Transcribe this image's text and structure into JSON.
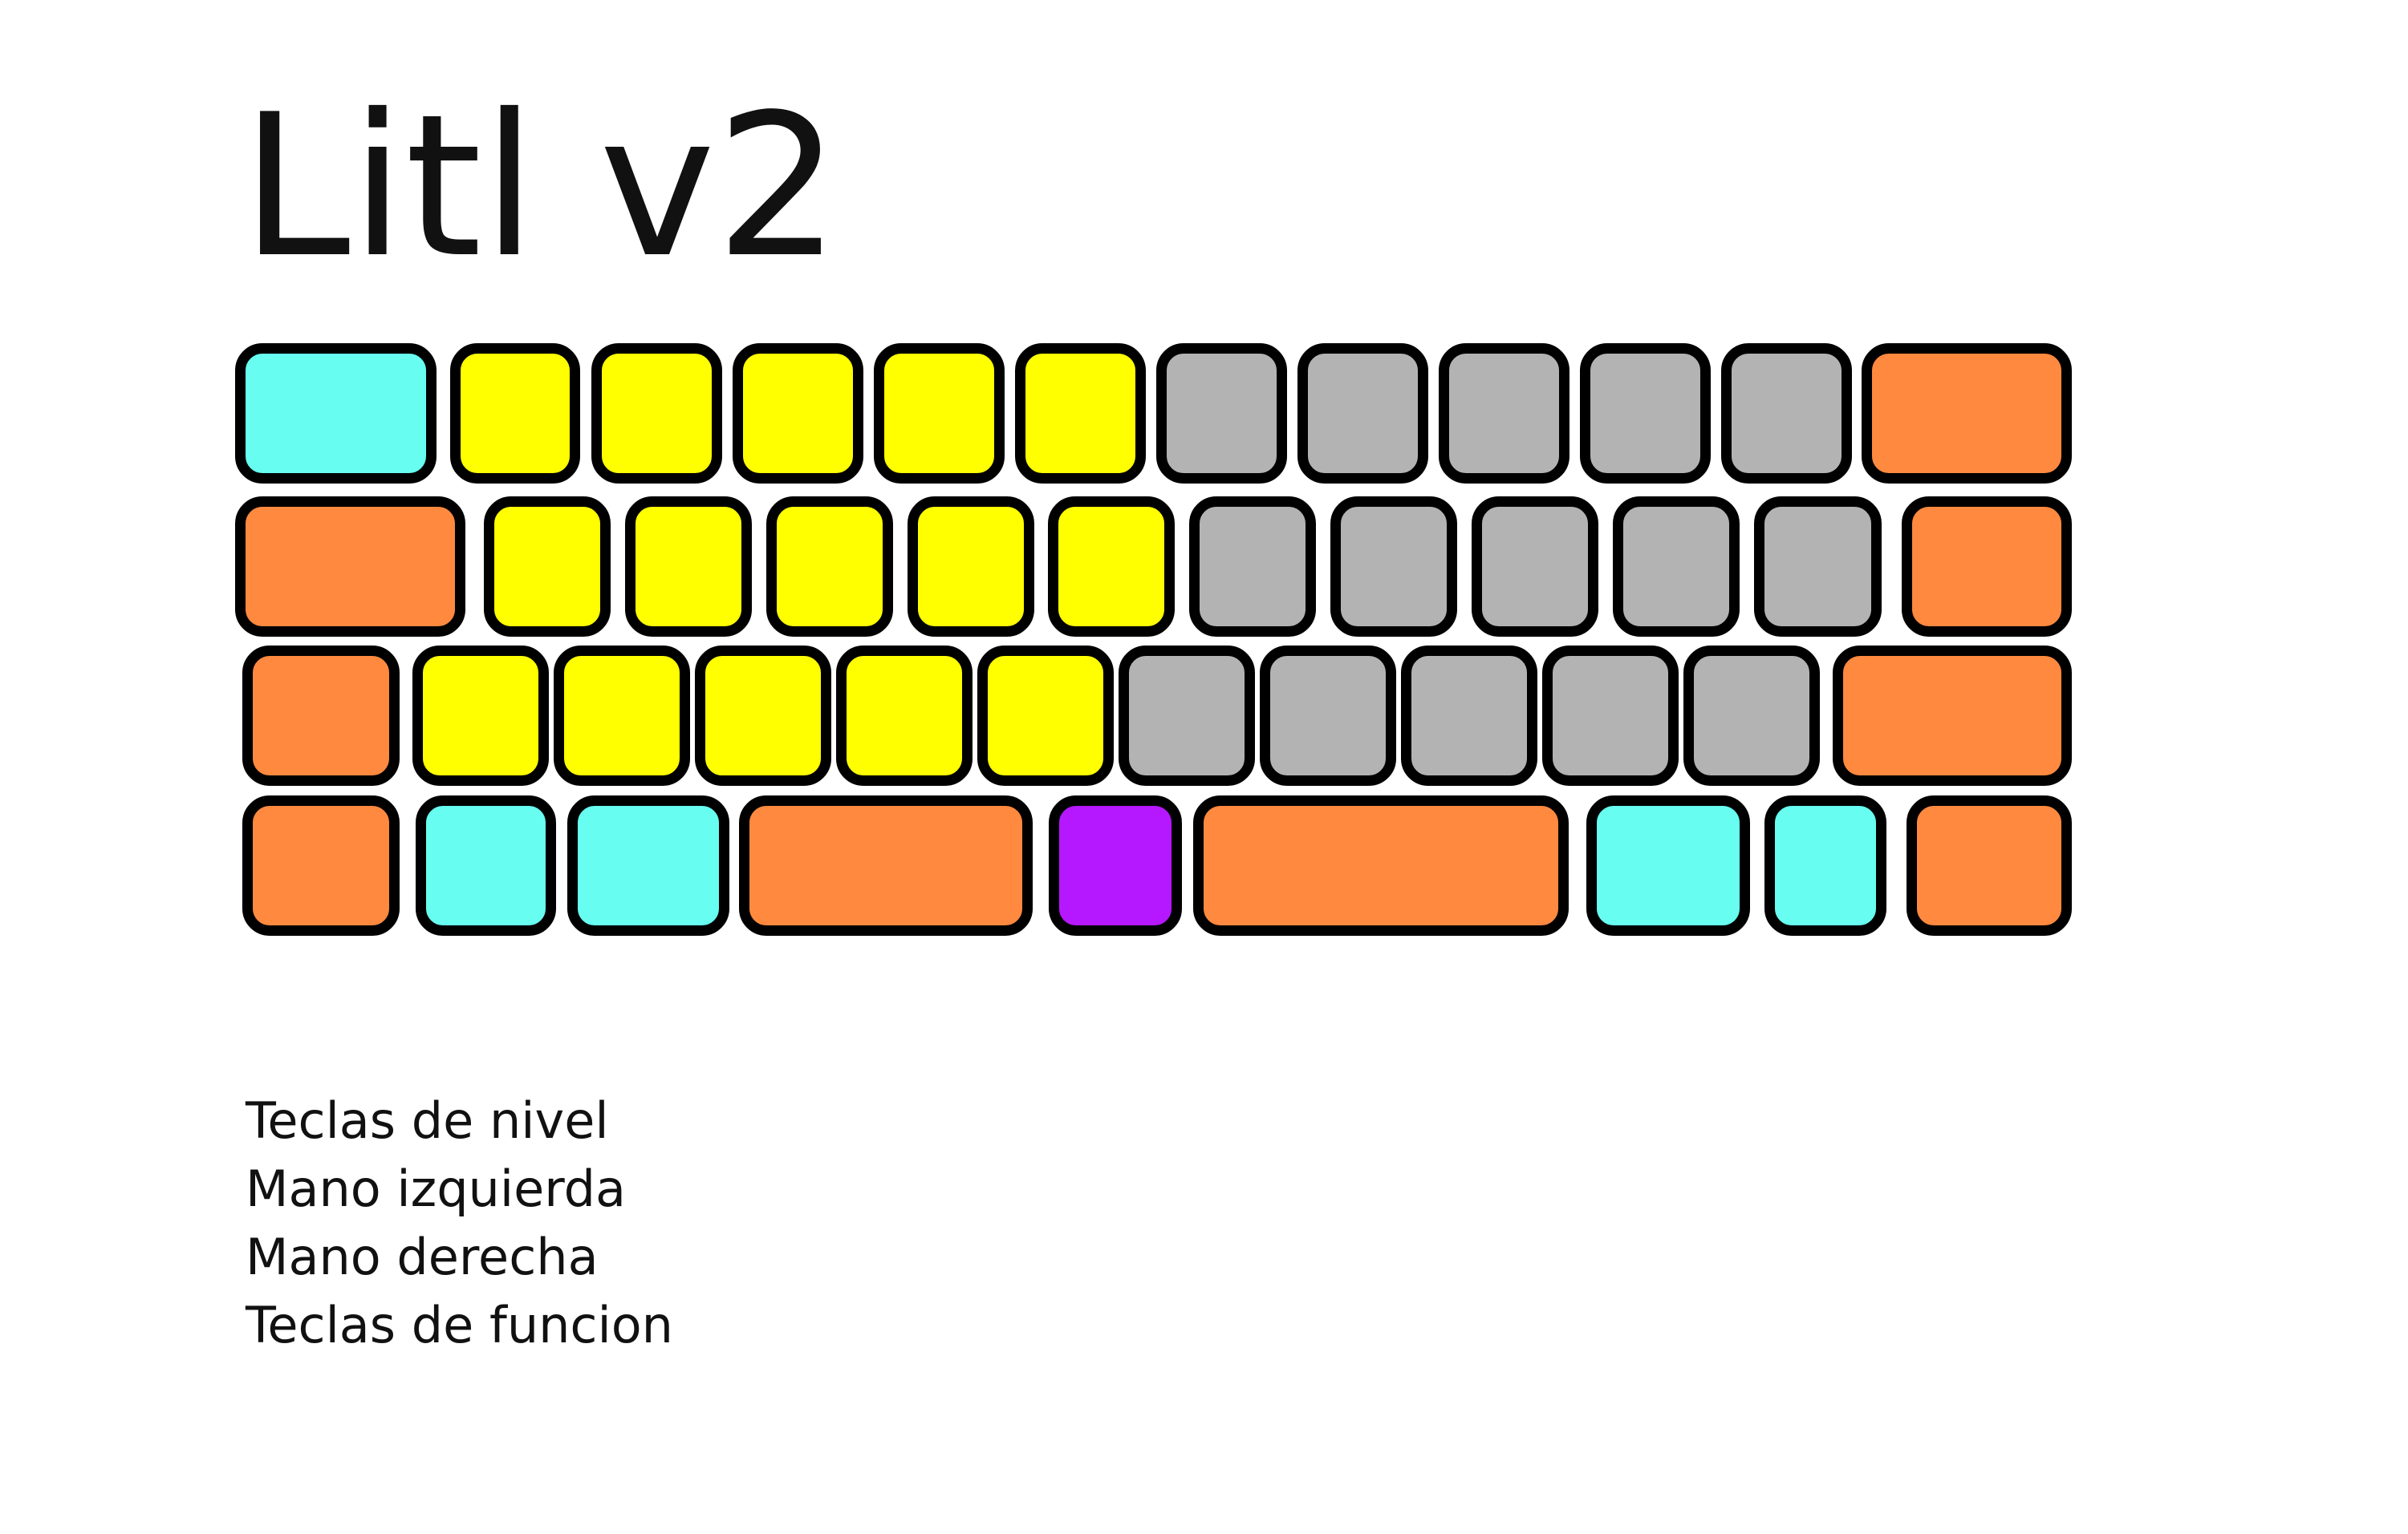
{
  "title": "Litl v2",
  "colors": {
    "level_keys": "#67fdf0",
    "left_hand": "#ffff00",
    "right_hand": "#b3b3b3",
    "function_keys": "#fe893f",
    "special_key": "#b518fe",
    "outline": "#000000"
  },
  "legend": [
    {
      "label": "Teclas de nivel"
    },
    {
      "label": "Mano izquierda"
    },
    {
      "label": "Mano derecha"
    },
    {
      "label": "Teclas de funcion"
    }
  ],
  "keyboard": {
    "rows": [
      {
        "keys": [
          "level_keys",
          "left_hand",
          "left_hand",
          "left_hand",
          "left_hand",
          "left_hand",
          "right_hand",
          "right_hand",
          "right_hand",
          "right_hand",
          "right_hand",
          "function_keys"
        ]
      },
      {
        "keys": [
          "function_keys",
          "left_hand",
          "left_hand",
          "left_hand",
          "left_hand",
          "left_hand",
          "right_hand",
          "right_hand",
          "right_hand",
          "right_hand",
          "right_hand",
          "function_keys"
        ]
      },
      {
        "keys": [
          "function_keys",
          "left_hand",
          "left_hand",
          "left_hand",
          "left_hand",
          "left_hand",
          "right_hand",
          "right_hand",
          "right_hand",
          "right_hand",
          "right_hand",
          "function_keys"
        ]
      },
      {
        "keys": [
          "function_keys",
          "level_keys",
          "level_keys",
          "function_keys",
          "special_key",
          "function_keys",
          "level_keys",
          "level_keys",
          "function_keys"
        ]
      }
    ]
  }
}
